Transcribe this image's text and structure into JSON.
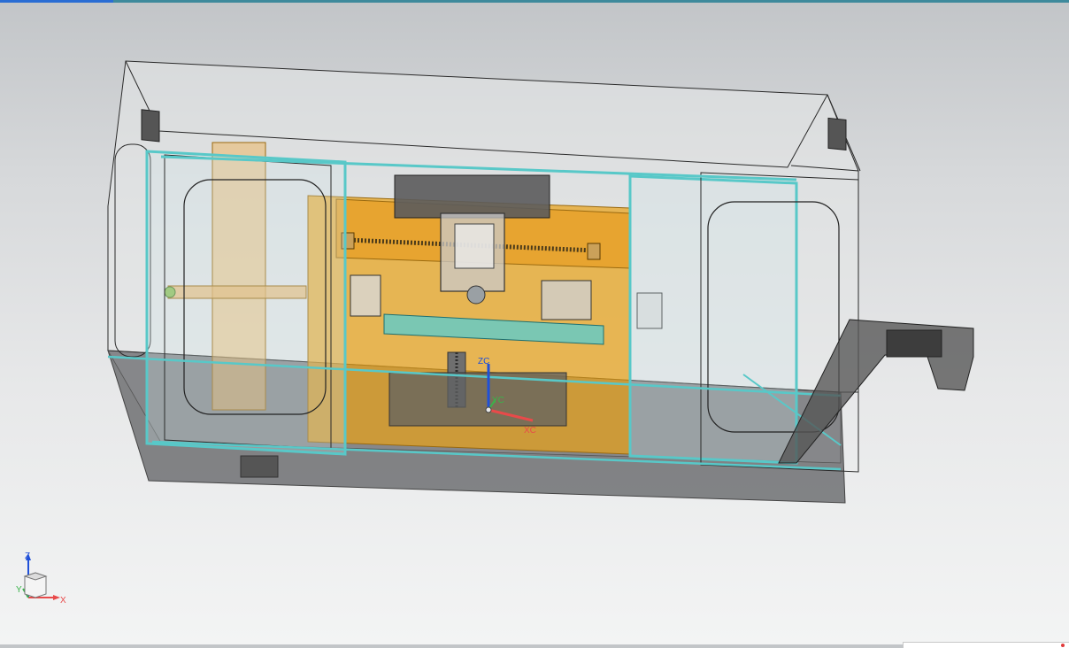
{
  "colors": {
    "frame_cyan": "#58c8c8",
    "machine_orange": "#e8a21a",
    "base_gray": "#6f7072",
    "accent_blue": "#2a6dd4"
  },
  "workcoords": {
    "zc": "ZC",
    "yc": "YC",
    "xc": "XC"
  },
  "triad": {
    "z": "Z",
    "y": "Y",
    "x": "X",
    "icon": "view-triad-icon"
  }
}
